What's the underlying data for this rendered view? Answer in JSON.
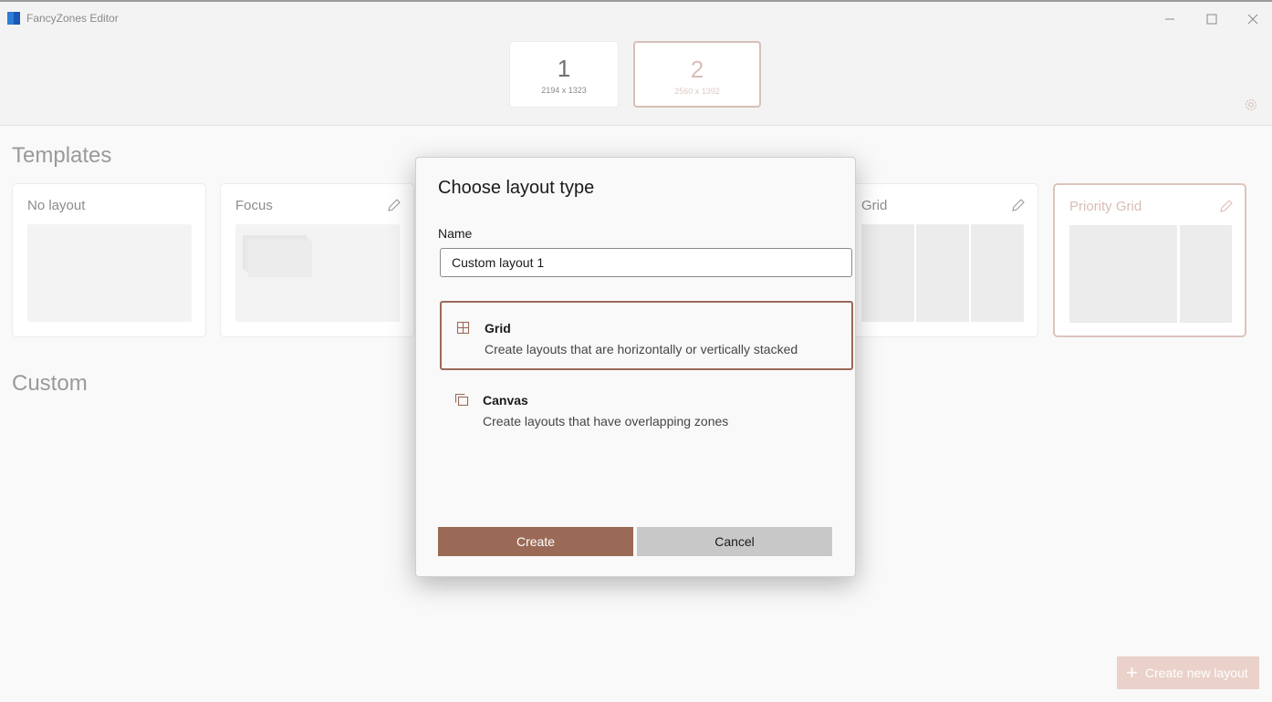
{
  "window": {
    "title": "FancyZones Editor",
    "minimize_icon": "minimize-icon",
    "maximize_icon": "maximize-icon",
    "close_icon": "close-icon"
  },
  "monitors": [
    {
      "number": "1",
      "resolution": "2194 x 1323",
      "selected": false
    },
    {
      "number": "2",
      "resolution": "2560 x 1392",
      "selected": true
    }
  ],
  "templates_heading": "Templates",
  "custom_heading": "Custom",
  "templates": [
    {
      "label": "No layout",
      "editable": false,
      "selected": false
    },
    {
      "label": "Focus",
      "editable": true,
      "selected": false
    },
    {
      "label": "Grid",
      "editable": true,
      "selected": false
    },
    {
      "label": "Priority Grid",
      "editable": true,
      "selected": true
    }
  ],
  "create_new_layout": "Create new layout",
  "dialog": {
    "title": "Choose layout type",
    "name_label": "Name",
    "name_value": "Custom layout 1",
    "options": [
      {
        "title": "Grid",
        "description": "Create layouts that are horizontally or vertically stacked",
        "icon": "grid-icon",
        "selected": true
      },
      {
        "title": "Canvas",
        "description": "Create layouts that have overlapping zones",
        "icon": "canvas-icon",
        "selected": false
      }
    ],
    "create_label": "Create",
    "cancel_label": "Cancel"
  },
  "colors": {
    "accent": "#9b6a56",
    "accent_light": "#dcc4bd"
  }
}
